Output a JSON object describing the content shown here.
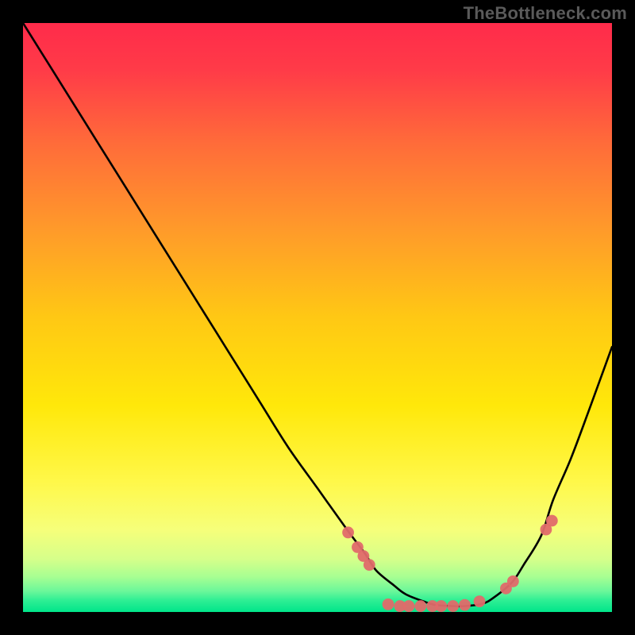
{
  "watermark": "TheBottleneck.com",
  "colors": {
    "curve": "#000000",
    "markers": "#e06a6a",
    "gradient_top": "#ff2b4a",
    "gradient_mid": "#ffd400",
    "gradient_bottom": "#00e58a",
    "background": "#000000"
  },
  "chart_data": {
    "type": "line",
    "title": "",
    "xlabel": "",
    "ylabel": "",
    "xlim": [
      0,
      100
    ],
    "ylim": [
      0,
      100
    ],
    "series": [
      {
        "name": "bottleneck-curve",
        "x": [
          0,
          5,
          10,
          15,
          20,
          25,
          30,
          35,
          40,
          45,
          50,
          55,
          58,
          60,
          63,
          65,
          68,
          70,
          73,
          75,
          78,
          80,
          83,
          85,
          88,
          90,
          93,
          96,
          100
        ],
        "y": [
          100,
          92,
          84,
          76,
          68,
          60,
          52,
          44,
          36,
          28,
          21,
          14,
          10,
          7,
          4.5,
          3,
          1.8,
          1.2,
          1,
          1,
          1.4,
          2.5,
          5,
          8,
          13,
          19,
          26,
          34,
          45
        ]
      }
    ],
    "markers": [
      {
        "x": 55.2,
        "y": 13.5
      },
      {
        "x": 56.8,
        "y": 11.0
      },
      {
        "x": 57.8,
        "y": 9.5
      },
      {
        "x": 58.8,
        "y": 8.0
      },
      {
        "x": 62.0,
        "y": 1.3
      },
      {
        "x": 64.0,
        "y": 1.0
      },
      {
        "x": 65.5,
        "y": 1.0
      },
      {
        "x": 67.5,
        "y": 1.0
      },
      {
        "x": 69.5,
        "y": 1.0
      },
      {
        "x": 71.0,
        "y": 1.0
      },
      {
        "x": 73.0,
        "y": 1.0
      },
      {
        "x": 75.0,
        "y": 1.2
      },
      {
        "x": 77.5,
        "y": 1.8
      },
      {
        "x": 82.0,
        "y": 4.0
      },
      {
        "x": 83.2,
        "y": 5.2
      },
      {
        "x": 88.8,
        "y": 14.0
      },
      {
        "x": 89.8,
        "y": 15.5
      }
    ]
  }
}
